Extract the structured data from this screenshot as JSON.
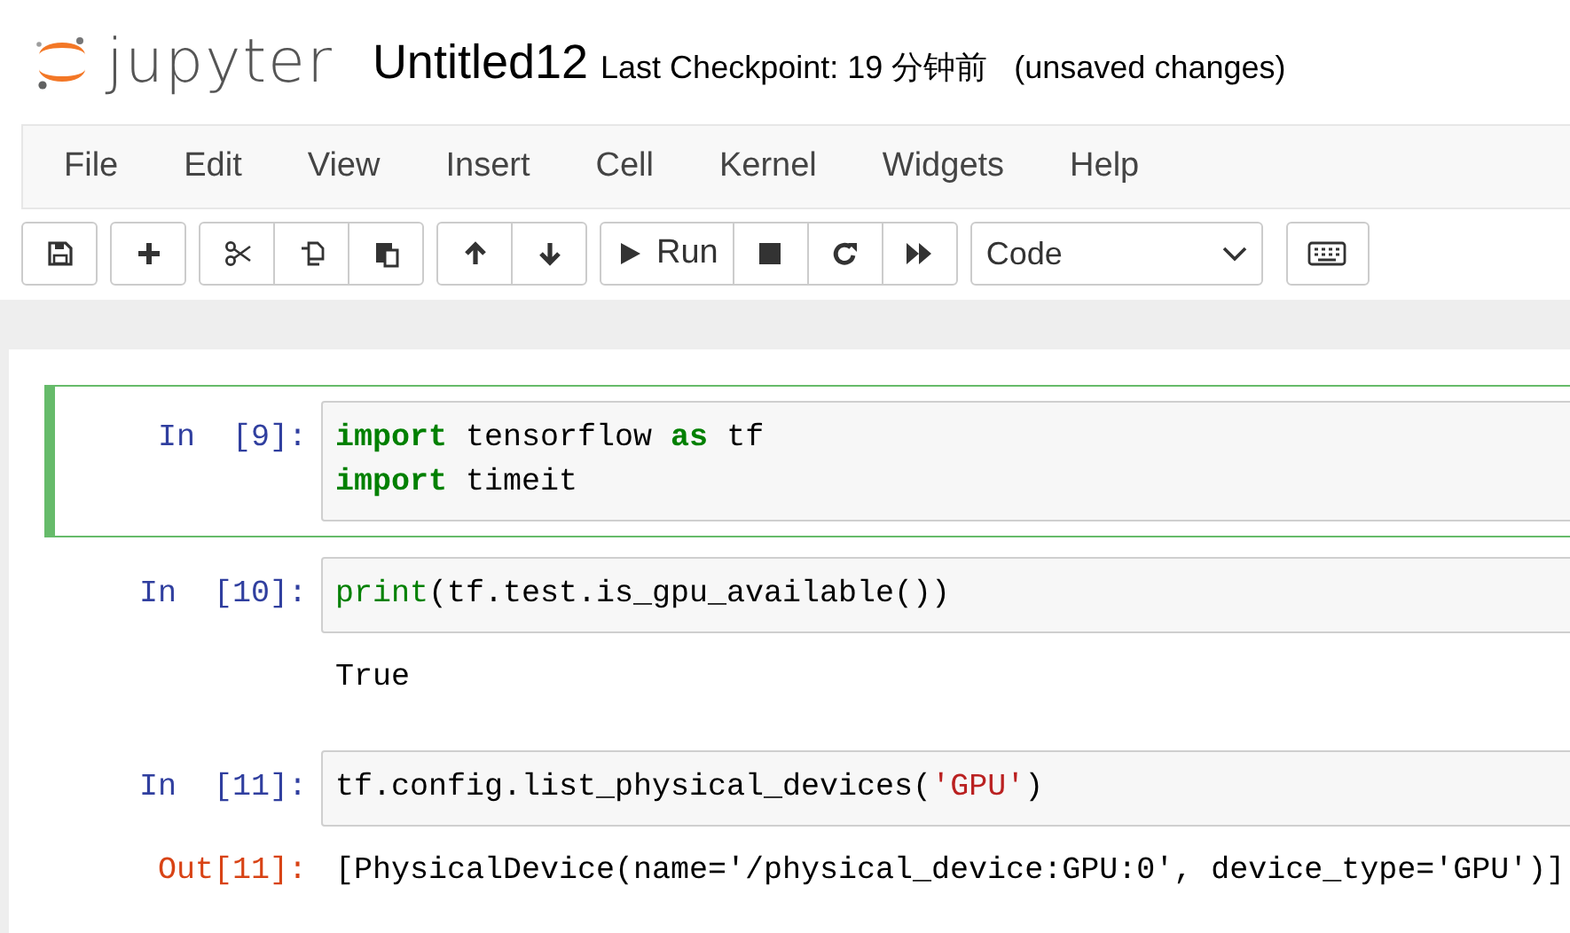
{
  "header": {
    "logo": "jupyter",
    "notebook_name": "Untitled12",
    "checkpoint": "Last Checkpoint: 19 分钟前",
    "autosave_status": "(unsaved changes)"
  },
  "menu": [
    "File",
    "Edit",
    "View",
    "Insert",
    "Cell",
    "Kernel",
    "Widgets",
    "Help"
  ],
  "toolbar": {
    "groups": [
      [
        {
          "kind": "save"
        }
      ],
      [
        {
          "kind": "add"
        }
      ],
      [
        {
          "kind": "cut"
        },
        {
          "kind": "copy"
        },
        {
          "kind": "paste"
        }
      ],
      [
        {
          "kind": "up"
        },
        {
          "kind": "down"
        }
      ],
      [
        {
          "kind": "run",
          "label": "Run"
        },
        {
          "kind": "stop"
        },
        {
          "kind": "restart"
        },
        {
          "kind": "fastforward"
        }
      ]
    ],
    "cell_type": "Code"
  },
  "cells": [
    {
      "prompt": "In  [9]:",
      "selected": true,
      "lines": [
        [
          {
            "text": "import",
            "kind": "keyword"
          },
          {
            "text": " tensorflow ",
            "kind": "plain"
          },
          {
            "text": "as",
            "kind": "keyword"
          },
          {
            "text": " tf",
            "kind": "plain"
          }
        ],
        [
          {
            "text": "import",
            "kind": "keyword"
          },
          {
            "text": " timeit",
            "kind": "plain"
          }
        ]
      ]
    },
    {
      "prompt": "In  [10]:",
      "selected": false,
      "lines": [
        [
          {
            "text": "print",
            "kind": "builtin"
          },
          {
            "text": "(tf.test.is_gpu_available())",
            "kind": "plain"
          }
        ]
      ],
      "output": {
        "text": "True"
      }
    },
    {
      "prompt": "In  [11]:",
      "selected": false,
      "lines": [
        [
          {
            "text": "tf.config.list_physical_devices(",
            "kind": "plain"
          },
          {
            "text": "'GPU'",
            "kind": "string"
          },
          {
            "text": ")",
            "kind": "plain"
          }
        ]
      ],
      "output": {
        "prompt": "Out[11]:",
        "text": "[PhysicalDevice(name='/physical_device:GPU:0', device_type='GPU')]"
      }
    }
  ]
}
